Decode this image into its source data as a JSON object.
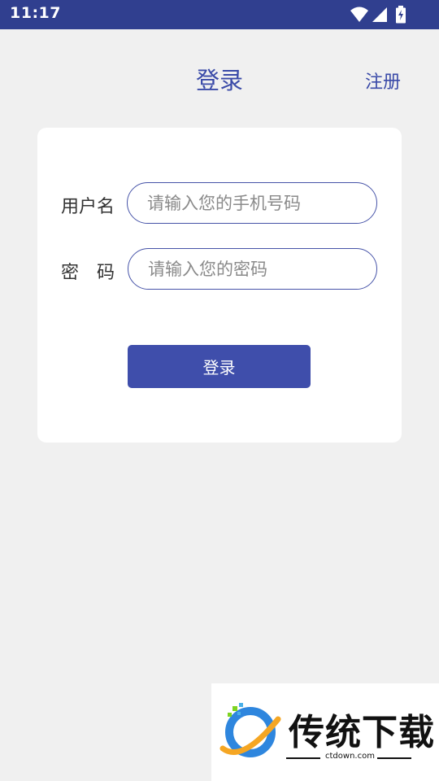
{
  "status_bar": {
    "time": "11:17",
    "icons": [
      "wifi-icon",
      "cell-signal-icon",
      "battery-charging-icon"
    ]
  },
  "header": {
    "title": "登录",
    "register_label": "注册"
  },
  "form": {
    "username": {
      "label": "用户名",
      "placeholder": "请输入您的手机号码",
      "value": ""
    },
    "password": {
      "label": "密　码",
      "placeholder": "请输入您的密码",
      "value": ""
    },
    "login_button_label": "登录"
  },
  "watermark": {
    "brand": "传统下载",
    "url": "ctdown.com"
  },
  "colors": {
    "status_bar": "#303f8f",
    "accent": "#3f4eab",
    "background": "#f0f0f0",
    "card": "#ffffff"
  }
}
